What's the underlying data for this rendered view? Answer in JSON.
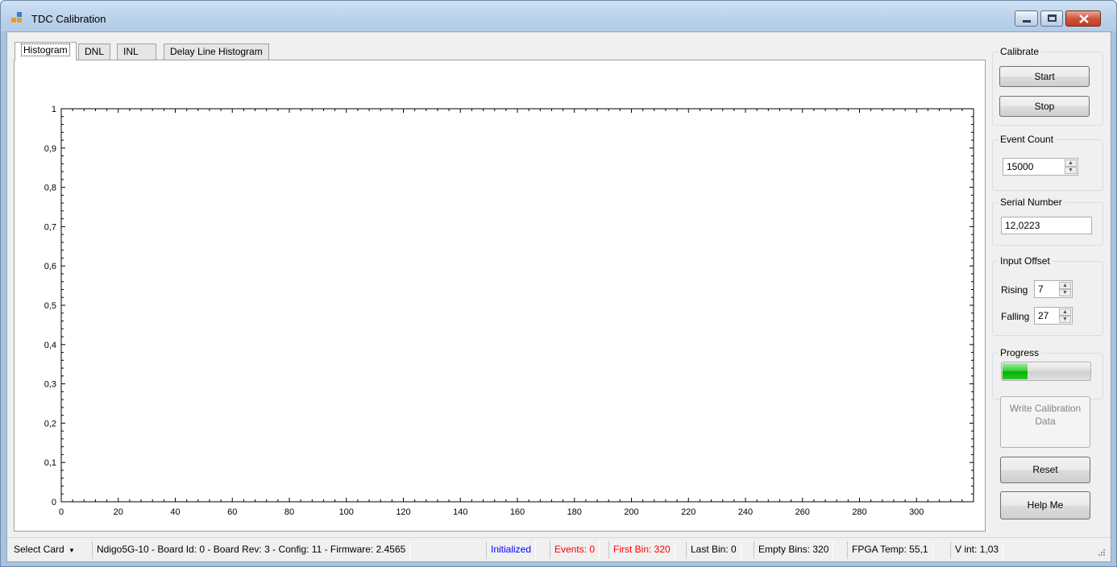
{
  "window": {
    "title": "TDC Calibration"
  },
  "tabs": [
    {
      "label": "Histogram"
    },
    {
      "label": "DNL"
    },
    {
      "label": "INL"
    },
    {
      "label": "Delay Line Histogram"
    }
  ],
  "chart_data": {
    "type": "bar",
    "title": "",
    "xlabel": "",
    "ylabel": "",
    "xlim": [
      0,
      320
    ],
    "ylim": [
      0,
      1
    ],
    "x_ticks": [
      0,
      20,
      40,
      60,
      80,
      100,
      120,
      140,
      160,
      180,
      200,
      220,
      240,
      260,
      280,
      300
    ],
    "y_ticks": [
      "0",
      "0,1",
      "0,2",
      "0,3",
      "0,4",
      "0,5",
      "0,6",
      "0,7",
      "0,8",
      "0,9",
      "1"
    ],
    "grid": false,
    "series": []
  },
  "calibrate": {
    "label": "Calibrate",
    "start": "Start",
    "stop": "Stop"
  },
  "event_count": {
    "label": "Event Count",
    "value": "15000"
  },
  "serial_number": {
    "label": "Serial Number",
    "value": "12,0223"
  },
  "input_offset": {
    "label": "Input Offset",
    "rising_label": "Rising",
    "rising_value": "7",
    "falling_label": "Falling",
    "falling_value": "27"
  },
  "progress": {
    "label": "Progress",
    "fraction": 0.28,
    "fill_color": "#1ec21e"
  },
  "buttons": {
    "write_calibration": "Write Calibration Data",
    "reset": "Reset",
    "help": "Help Me"
  },
  "status": {
    "select_card": "Select Card",
    "card_info": "Ndigo5G-10 - Board Id: 0 - Board Rev: 3 - Config: 11 - Firmware: 2.4565",
    "state": "Initialized",
    "events": "Events: 0",
    "first_bin": "First Bin: 320",
    "last_bin": "Last Bin: 0",
    "empty_bins": "Empty Bins: 320",
    "fpga_temp": "FPGA Temp: 55,1",
    "v_int": "V int: 1,03",
    "state_color": "#0000ff",
    "warn_color": "#ff0000"
  }
}
